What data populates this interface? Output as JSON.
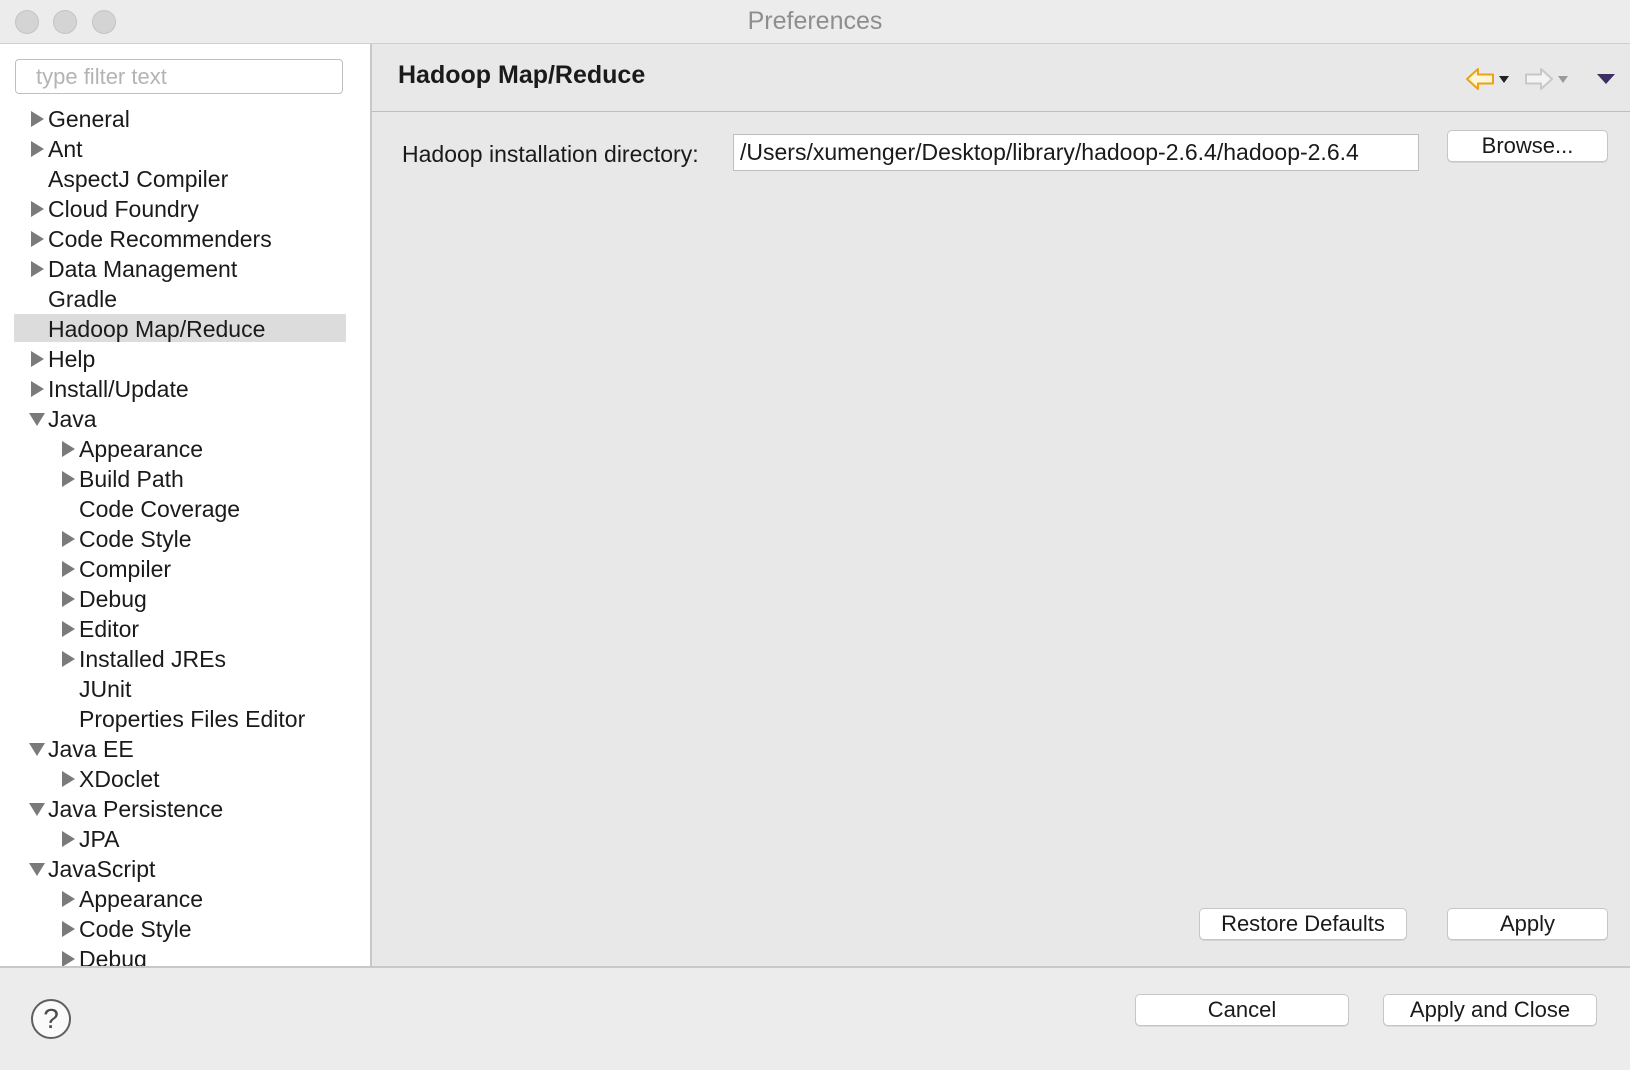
{
  "window": {
    "title": "Preferences"
  },
  "filter": {
    "placeholder": "type filter text",
    "value": ""
  },
  "tree": [
    {
      "label": "General",
      "indent": 0,
      "expander": "collapsed",
      "selected": false
    },
    {
      "label": "Ant",
      "indent": 0,
      "expander": "collapsed",
      "selected": false
    },
    {
      "label": "AspectJ Compiler",
      "indent": 0,
      "expander": "none",
      "selected": false
    },
    {
      "label": "Cloud Foundry",
      "indent": 0,
      "expander": "collapsed",
      "selected": false
    },
    {
      "label": "Code Recommenders",
      "indent": 0,
      "expander": "collapsed",
      "selected": false
    },
    {
      "label": "Data Management",
      "indent": 0,
      "expander": "collapsed",
      "selected": false
    },
    {
      "label": "Gradle",
      "indent": 0,
      "expander": "none",
      "selected": false
    },
    {
      "label": "Hadoop Map/Reduce",
      "indent": 0,
      "expander": "none",
      "selected": true
    },
    {
      "label": "Help",
      "indent": 0,
      "expander": "collapsed",
      "selected": false
    },
    {
      "label": "Install/Update",
      "indent": 0,
      "expander": "collapsed",
      "selected": false
    },
    {
      "label": "Java",
      "indent": 0,
      "expander": "expanded",
      "selected": false
    },
    {
      "label": "Appearance",
      "indent": 1,
      "expander": "collapsed",
      "selected": false
    },
    {
      "label": "Build Path",
      "indent": 1,
      "expander": "collapsed",
      "selected": false
    },
    {
      "label": "Code Coverage",
      "indent": 1,
      "expander": "none",
      "selected": false
    },
    {
      "label": "Code Style",
      "indent": 1,
      "expander": "collapsed",
      "selected": false
    },
    {
      "label": "Compiler",
      "indent": 1,
      "expander": "collapsed",
      "selected": false
    },
    {
      "label": "Debug",
      "indent": 1,
      "expander": "collapsed",
      "selected": false
    },
    {
      "label": "Editor",
      "indent": 1,
      "expander": "collapsed",
      "selected": false
    },
    {
      "label": "Installed JREs",
      "indent": 1,
      "expander": "collapsed",
      "selected": false
    },
    {
      "label": "JUnit",
      "indent": 1,
      "expander": "none",
      "selected": false
    },
    {
      "label": "Properties Files Editor",
      "indent": 1,
      "expander": "none",
      "selected": false
    },
    {
      "label": "Java EE",
      "indent": 0,
      "expander": "expanded",
      "selected": false
    },
    {
      "label": "XDoclet",
      "indent": 1,
      "expander": "collapsed",
      "selected": false
    },
    {
      "label": "Java Persistence",
      "indent": 0,
      "expander": "expanded",
      "selected": false
    },
    {
      "label": "JPA",
      "indent": 1,
      "expander": "collapsed",
      "selected": false
    },
    {
      "label": "JavaScript",
      "indent": 0,
      "expander": "expanded",
      "selected": false
    },
    {
      "label": "Appearance",
      "indent": 1,
      "expander": "collapsed",
      "selected": false
    },
    {
      "label": "Code Style",
      "indent": 1,
      "expander": "collapsed",
      "selected": false
    },
    {
      "label": "Debug",
      "indent": 1,
      "expander": "collapsed",
      "selected": false
    }
  ],
  "page": {
    "title": "Hadoop Map/Reduce",
    "field_label": "Hadoop installation directory:",
    "field_value": "/Users/xumenger/Desktop/library/hadoop-2.6.4/hadoop-2.6.4",
    "browse_label": "Browse...",
    "restore_defaults_label": "Restore Defaults",
    "apply_label": "Apply"
  },
  "footer": {
    "help_symbol": "?",
    "cancel_label": "Cancel",
    "apply_close_label": "Apply and Close"
  },
  "colors": {
    "back_arrow": "#e8a317",
    "forward_arrow_disabled": "#c8c8c8",
    "view_menu": "#3d2d63",
    "selection_bg": "#dcdcdc"
  }
}
